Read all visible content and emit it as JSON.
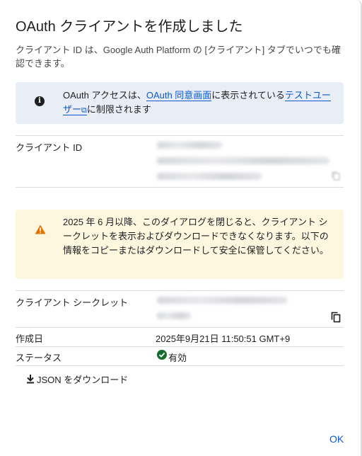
{
  "dialog": {
    "title": "OAuth クライアントを作成しました",
    "subtitle": "クライアント ID は、Google Auth Platform の [クライアント] タブでいつでも確認できます。"
  },
  "info": {
    "icon": "info-icon",
    "text_before": "OAuth アクセスは、",
    "link1": "OAuth 同意画面",
    "text_middle": "に表示されている",
    "link2": "テストユーザー",
    "text_after": "に制限されます"
  },
  "client_id": {
    "label": "クライアント ID"
  },
  "warning": {
    "icon": "warning-icon",
    "text": "2025 年 6 月以降、このダイアログを閉じると、クライアント シークレットを表示およびダウンロードできなくなります。以下の情報をコピーまたはダウンロードして安全に保管してください。"
  },
  "client_secret": {
    "label": "クライアント シークレット"
  },
  "created": {
    "label": "作成日",
    "value": "2025年9月21日 11:50:51 GMT+9"
  },
  "status": {
    "label": "ステータス",
    "value": "有効",
    "color": "#146c2e"
  },
  "actions": {
    "download_label": "JSON をダウンロード",
    "ok_label": "OK"
  },
  "colors": {
    "accent": "#0b57d0",
    "info_bg": "#e9eef6",
    "warning_bg": "#fef7e0",
    "warning_icon": "#e37400"
  }
}
